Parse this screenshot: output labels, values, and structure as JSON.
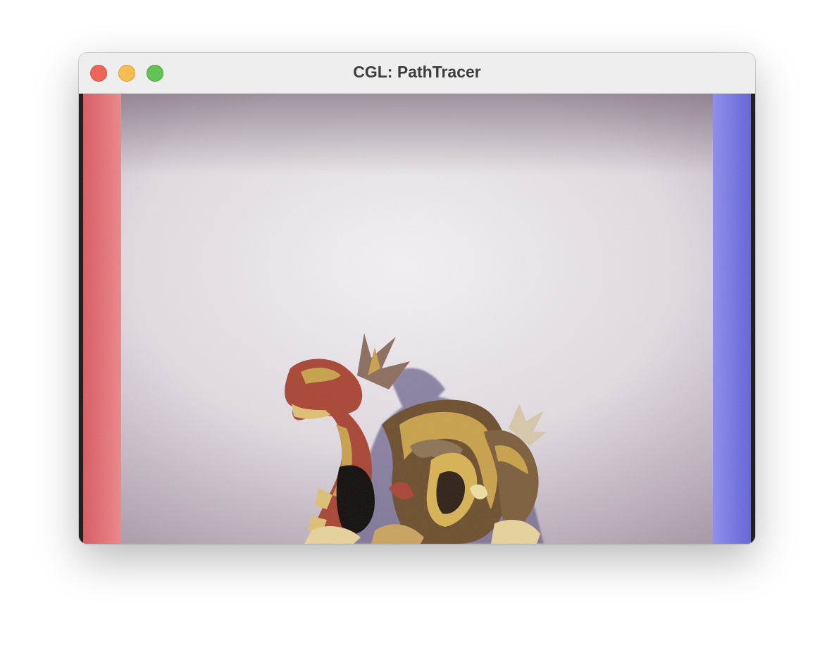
{
  "window": {
    "title": "CGL: PathTracer",
    "controls": {
      "close_icon": "close-icon",
      "minimize_icon": "minimize-icon",
      "maximize_icon": "maximize-icon"
    }
  },
  "scene": {
    "description_icon": "render-viewport",
    "colors": {
      "left_wall": "#e8747a",
      "right_wall": "#7a7ae8",
      "back_wall": "#ece7ee",
      "dragon_red": "#a8402e",
      "dragon_gold": "#c9a046",
      "dragon_shadow": "#6b5e8a"
    }
  }
}
